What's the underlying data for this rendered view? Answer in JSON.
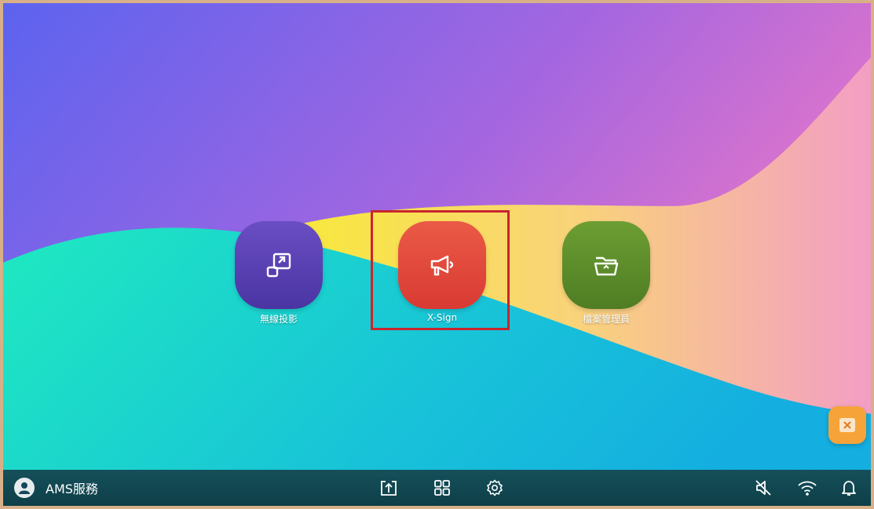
{
  "desktop": {
    "apps": [
      {
        "label": "無線投影",
        "icon": "screen-cast-icon",
        "color": "#5a3fb0"
      },
      {
        "label": "X-Sign",
        "icon": "megaphone-icon",
        "color": "#e24a3c"
      },
      {
        "label": "檔案管理員",
        "icon": "folder-icon",
        "color": "#5c8c2c"
      }
    ],
    "highlight_color": "#c9252d",
    "floating_button": {
      "icon": "close-box-icon",
      "color": "#f6a43a"
    }
  },
  "taskbar": {
    "user_label": "AMS服務",
    "user_icon": "user-avatar-icon",
    "center_icons": [
      "share-upload-icon",
      "apps-grid-icon",
      "settings-gear-icon"
    ],
    "right_icons": [
      "speaker-muted-icon",
      "wifi-icon",
      "bell-icon"
    ],
    "background": "#12485a"
  }
}
